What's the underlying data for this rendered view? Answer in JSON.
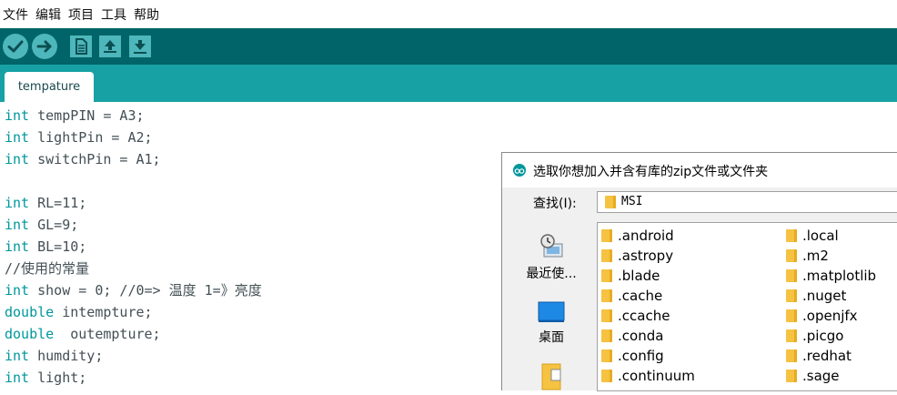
{
  "menu": [
    "文件",
    "编辑",
    "项目",
    "工具",
    "帮助"
  ],
  "toolbar": {
    "buttons": [
      "verify-icon",
      "upload-icon",
      "new-icon",
      "open-icon",
      "save-icon"
    ]
  },
  "tab": {
    "label": "tempature"
  },
  "code": [
    {
      "kw": "int",
      "rest": " tempPIN = A3;"
    },
    {
      "kw": "int",
      "rest": " lightPin = A2;"
    },
    {
      "kw": "int",
      "rest": " switchPin = A1;"
    },
    {
      "kw": "",
      "rest": ""
    },
    {
      "kw": "int",
      "rest": " RL=11;"
    },
    {
      "kw": "int",
      "rest": " GL=9;"
    },
    {
      "kw": "int",
      "rest": " BL=10;"
    },
    {
      "kw": "",
      "rest": "//使用的常量"
    },
    {
      "kw": "int",
      "rest": " show = 0; //0=> 温度 1=》亮度"
    },
    {
      "kw": "double",
      "rest": " intempture;"
    },
    {
      "kw": "double",
      "rest": "  outempture;"
    },
    {
      "kw": "int",
      "rest": " humdity;"
    },
    {
      "kw": "int",
      "rest": " light;"
    }
  ],
  "dialog": {
    "title": "选取你想加入并含有库的zip文件或文件夹",
    "look_in_label": "查找(I):",
    "look_in_value": "MSI",
    "places": [
      "最近使...",
      "桌面"
    ],
    "files_col1": [
      ".android",
      ".astropy",
      ".blade",
      ".cache",
      ".ccache",
      ".conda",
      ".config",
      ".continuum"
    ],
    "files_col2": [
      ".local",
      ".m2",
      ".matplotlib",
      ".nuget",
      ".openjfx",
      ".picgo",
      ".redhat",
      ".sage"
    ]
  },
  "colors": {
    "toolbar_bg": "#006468",
    "tabbar_bg": "#17a1a5",
    "keyword": "#00979c"
  }
}
